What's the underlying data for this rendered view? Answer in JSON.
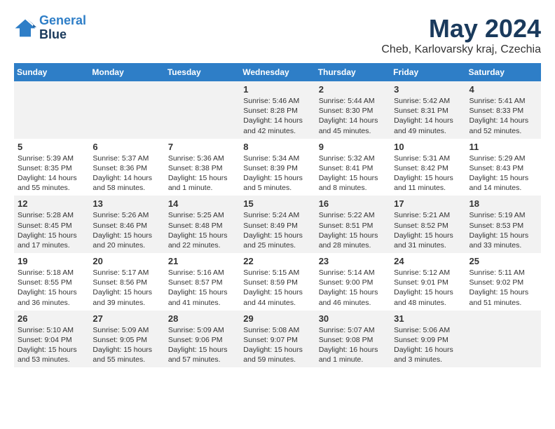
{
  "header": {
    "logo_line1": "General",
    "logo_line2": "Blue",
    "month_year": "May 2024",
    "location": "Cheb, Karlovarsky kraj, Czechia"
  },
  "days_of_week": [
    "Sunday",
    "Monday",
    "Tuesday",
    "Wednesday",
    "Thursday",
    "Friday",
    "Saturday"
  ],
  "weeks": [
    [
      {
        "num": "",
        "info": ""
      },
      {
        "num": "",
        "info": ""
      },
      {
        "num": "",
        "info": ""
      },
      {
        "num": "1",
        "info": "Sunrise: 5:46 AM\nSunset: 8:28 PM\nDaylight: 14 hours\nand 42 minutes."
      },
      {
        "num": "2",
        "info": "Sunrise: 5:44 AM\nSunset: 8:30 PM\nDaylight: 14 hours\nand 45 minutes."
      },
      {
        "num": "3",
        "info": "Sunrise: 5:42 AM\nSunset: 8:31 PM\nDaylight: 14 hours\nand 49 minutes."
      },
      {
        "num": "4",
        "info": "Sunrise: 5:41 AM\nSunset: 8:33 PM\nDaylight: 14 hours\nand 52 minutes."
      }
    ],
    [
      {
        "num": "5",
        "info": "Sunrise: 5:39 AM\nSunset: 8:35 PM\nDaylight: 14 hours\nand 55 minutes."
      },
      {
        "num": "6",
        "info": "Sunrise: 5:37 AM\nSunset: 8:36 PM\nDaylight: 14 hours\nand 58 minutes."
      },
      {
        "num": "7",
        "info": "Sunrise: 5:36 AM\nSunset: 8:38 PM\nDaylight: 15 hours\nand 1 minute."
      },
      {
        "num": "8",
        "info": "Sunrise: 5:34 AM\nSunset: 8:39 PM\nDaylight: 15 hours\nand 5 minutes."
      },
      {
        "num": "9",
        "info": "Sunrise: 5:32 AM\nSunset: 8:41 PM\nDaylight: 15 hours\nand 8 minutes."
      },
      {
        "num": "10",
        "info": "Sunrise: 5:31 AM\nSunset: 8:42 PM\nDaylight: 15 hours\nand 11 minutes."
      },
      {
        "num": "11",
        "info": "Sunrise: 5:29 AM\nSunset: 8:43 PM\nDaylight: 15 hours\nand 14 minutes."
      }
    ],
    [
      {
        "num": "12",
        "info": "Sunrise: 5:28 AM\nSunset: 8:45 PM\nDaylight: 15 hours\nand 17 minutes."
      },
      {
        "num": "13",
        "info": "Sunrise: 5:26 AM\nSunset: 8:46 PM\nDaylight: 15 hours\nand 20 minutes."
      },
      {
        "num": "14",
        "info": "Sunrise: 5:25 AM\nSunset: 8:48 PM\nDaylight: 15 hours\nand 22 minutes."
      },
      {
        "num": "15",
        "info": "Sunrise: 5:24 AM\nSunset: 8:49 PM\nDaylight: 15 hours\nand 25 minutes."
      },
      {
        "num": "16",
        "info": "Sunrise: 5:22 AM\nSunset: 8:51 PM\nDaylight: 15 hours\nand 28 minutes."
      },
      {
        "num": "17",
        "info": "Sunrise: 5:21 AM\nSunset: 8:52 PM\nDaylight: 15 hours\nand 31 minutes."
      },
      {
        "num": "18",
        "info": "Sunrise: 5:19 AM\nSunset: 8:53 PM\nDaylight: 15 hours\nand 33 minutes."
      }
    ],
    [
      {
        "num": "19",
        "info": "Sunrise: 5:18 AM\nSunset: 8:55 PM\nDaylight: 15 hours\nand 36 minutes."
      },
      {
        "num": "20",
        "info": "Sunrise: 5:17 AM\nSunset: 8:56 PM\nDaylight: 15 hours\nand 39 minutes."
      },
      {
        "num": "21",
        "info": "Sunrise: 5:16 AM\nSunset: 8:57 PM\nDaylight: 15 hours\nand 41 minutes."
      },
      {
        "num": "22",
        "info": "Sunrise: 5:15 AM\nSunset: 8:59 PM\nDaylight: 15 hours\nand 44 minutes."
      },
      {
        "num": "23",
        "info": "Sunrise: 5:14 AM\nSunset: 9:00 PM\nDaylight: 15 hours\nand 46 minutes."
      },
      {
        "num": "24",
        "info": "Sunrise: 5:12 AM\nSunset: 9:01 PM\nDaylight: 15 hours\nand 48 minutes."
      },
      {
        "num": "25",
        "info": "Sunrise: 5:11 AM\nSunset: 9:02 PM\nDaylight: 15 hours\nand 51 minutes."
      }
    ],
    [
      {
        "num": "26",
        "info": "Sunrise: 5:10 AM\nSunset: 9:04 PM\nDaylight: 15 hours\nand 53 minutes."
      },
      {
        "num": "27",
        "info": "Sunrise: 5:09 AM\nSunset: 9:05 PM\nDaylight: 15 hours\nand 55 minutes."
      },
      {
        "num": "28",
        "info": "Sunrise: 5:09 AM\nSunset: 9:06 PM\nDaylight: 15 hours\nand 57 minutes."
      },
      {
        "num": "29",
        "info": "Sunrise: 5:08 AM\nSunset: 9:07 PM\nDaylight: 15 hours\nand 59 minutes."
      },
      {
        "num": "30",
        "info": "Sunrise: 5:07 AM\nSunset: 9:08 PM\nDaylight: 16 hours\nand 1 minute."
      },
      {
        "num": "31",
        "info": "Sunrise: 5:06 AM\nSunset: 9:09 PM\nDaylight: 16 hours\nand 3 minutes."
      },
      {
        "num": "",
        "info": ""
      }
    ]
  ]
}
